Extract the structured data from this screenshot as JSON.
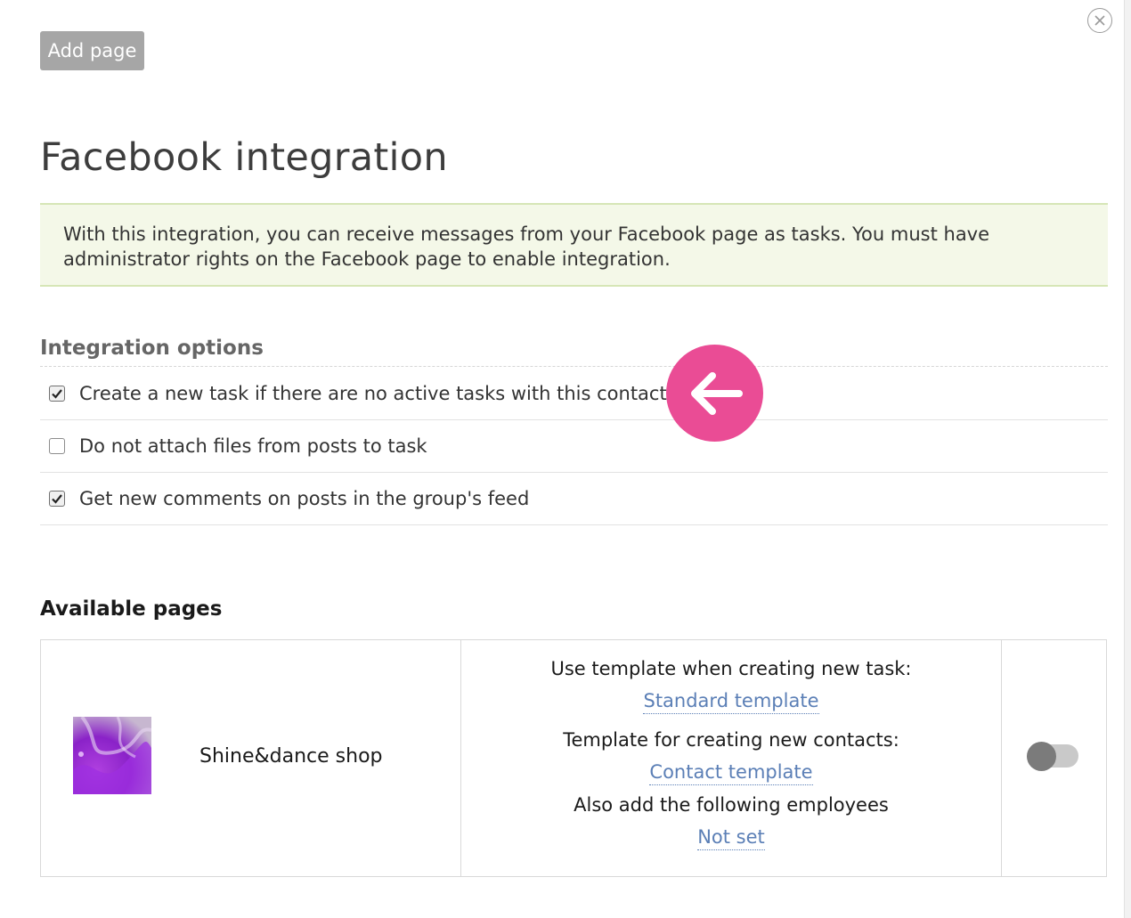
{
  "header": {
    "add_page_label": "Add page",
    "close_icon": "close-circle-icon"
  },
  "title": "Facebook integration",
  "info_text": "With this integration, you can receive messages from your Facebook page as tasks. You must have administrator rights on the Facebook page to enable integration.",
  "options": {
    "heading": "Integration options",
    "items": [
      {
        "label": "Create a new task if there are no active tasks with this contact",
        "checked": true
      },
      {
        "label": "Do not attach files from posts to task",
        "checked": false
      },
      {
        "label": "Get new comments on posts in the group's feed",
        "checked": true
      }
    ]
  },
  "pages": {
    "heading": "Available pages",
    "rows": [
      {
        "name": "Shine&dance shop",
        "task_template_label": "Use template when creating new task:",
        "task_template_value": "Standard template",
        "contact_template_label": "Template for creating new contacts:",
        "contact_template_value": "Contact template",
        "employees_label": "Also add the following employees",
        "employees_value": "Not set",
        "enabled": false
      }
    ]
  },
  "colors": {
    "accent_pink": "#ea4c95",
    "link_blue": "#5b7fb6",
    "info_bg": "#f4f8e8",
    "info_border": "#d6e6b6",
    "button_gray": "#a6a6a6"
  }
}
